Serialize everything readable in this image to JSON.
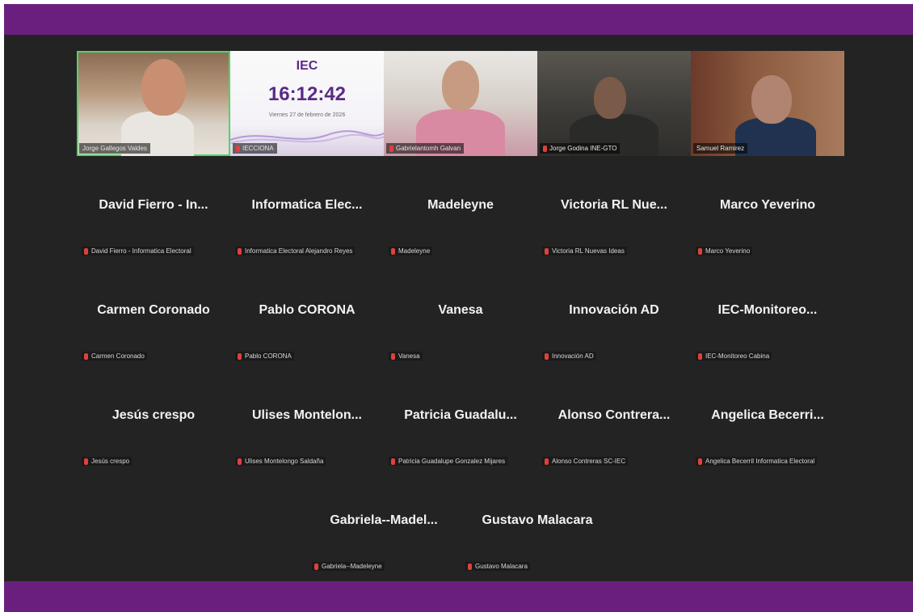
{
  "videos": [
    {
      "label": "Jorge Gallegos Valdes"
    },
    {
      "label": "IECCIONA",
      "logo": "IEC",
      "time": "16:12:42",
      "date": "Viernes 27 de febrero de 2026"
    },
    {
      "label": "Gabrielantomh Galvan"
    },
    {
      "label": "Jorge Godina INE-GTO"
    },
    {
      "label": "Samuel Ramirez"
    }
  ],
  "participants": [
    {
      "name": "David Fierro - In...",
      "label": "David Fierro - Informatica Electoral"
    },
    {
      "name": "Informatica Elec...",
      "label": "Informatica Electoral Alejandro Reyes"
    },
    {
      "name": "Madeleyne",
      "label": "Madeleyne"
    },
    {
      "name": "Victoria RL Nue...",
      "label": "Victoria RL Nuevas Ideas"
    },
    {
      "name": "Marco Yeverino",
      "label": "Marco Yeverino"
    },
    {
      "name": "Carmen Coronado",
      "label": "Carmen Coronado"
    },
    {
      "name": "Pablo CORONA",
      "label": "Pablo CORONA"
    },
    {
      "name": "Vanesa",
      "label": "Vanesa"
    },
    {
      "name": "Innovación AD",
      "label": "Innovación AD"
    },
    {
      "name": "IEC-Monitoreo...",
      "label": "IEC-Monitoreo Cabina"
    },
    {
      "name": "Jesús crespo",
      "label": "Jesús crespo"
    },
    {
      "name": "Ulises Montelon...",
      "label": "Ulises Montelongo Saldaña"
    },
    {
      "name": "Patricia Guadalu...",
      "label": "Patricia Guadalupe Gonzalez Mijares"
    },
    {
      "name": "Alonso Contrera...",
      "label": "Alonso Contreras SC-IEC"
    },
    {
      "name": "Angelica Becerri...",
      "label": "Angelica Becerril Informatica Electoral"
    },
    {
      "name": "Gabriela--Madel...",
      "label": "Gabriela--Madeleyne"
    },
    {
      "name": "Gustavo Malacara",
      "label": "Gustavo Malacara"
    }
  ],
  "colors": {
    "bar": "#6a1f7f",
    "background": "#232323",
    "active_border": "#4fd46a",
    "mic_muted": "#e0403a"
  }
}
